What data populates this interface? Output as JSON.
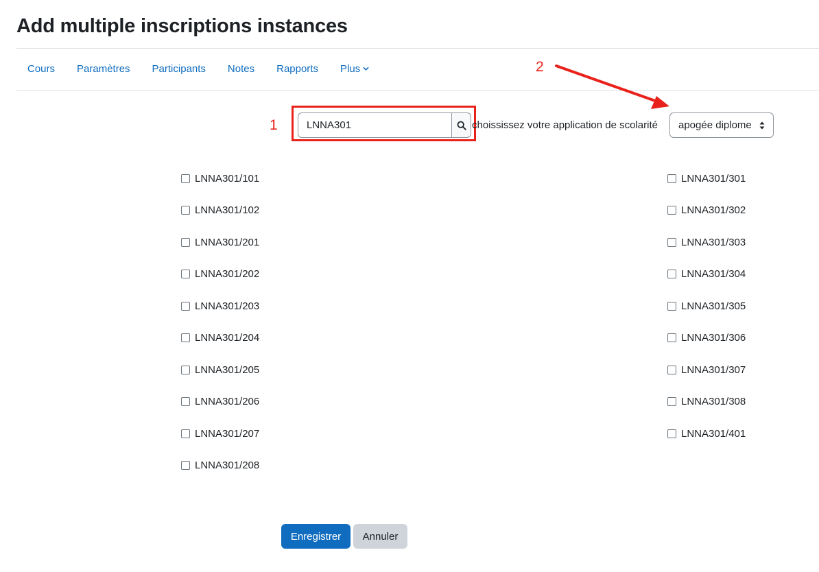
{
  "page": {
    "title": "Add multiple inscriptions instances"
  },
  "nav": {
    "items": [
      {
        "label": "Cours"
      },
      {
        "label": "Paramètres"
      },
      {
        "label": "Participants"
      },
      {
        "label": "Notes"
      },
      {
        "label": "Rapports"
      },
      {
        "label": "Plus"
      }
    ]
  },
  "annotations": {
    "one": "1",
    "two": "2",
    "color": "#e8221b"
  },
  "search": {
    "value": "LNNA301",
    "button_icon": "search-icon"
  },
  "scolarite": {
    "label": "choississez votre application de scolarité",
    "selected": "apogée diplome"
  },
  "checkboxes": {
    "left": [
      {
        "label": "LNNA301/101"
      },
      {
        "label": "LNNA301/102"
      },
      {
        "label": "LNNA301/201"
      },
      {
        "label": "LNNA301/202"
      },
      {
        "label": "LNNA301/203"
      },
      {
        "label": "LNNA301/204"
      },
      {
        "label": "LNNA301/205"
      },
      {
        "label": "LNNA301/206"
      },
      {
        "label": "LNNA301/207"
      },
      {
        "label": "LNNA301/208"
      }
    ],
    "right": [
      {
        "label": "LNNA301/301"
      },
      {
        "label": "LNNA301/302"
      },
      {
        "label": "LNNA301/303"
      },
      {
        "label": "LNNA301/304"
      },
      {
        "label": "LNNA301/305"
      },
      {
        "label": "LNNA301/306"
      },
      {
        "label": "LNNA301/307"
      },
      {
        "label": "LNNA301/308"
      },
      {
        "label": "LNNA301/401"
      }
    ]
  },
  "actions": {
    "save_label": "Enregistrer",
    "cancel_label": "Annuler"
  },
  "colors": {
    "primary": "#0f6cbf",
    "secondary": "#ced4da",
    "annotation_red": "#e8221b"
  }
}
